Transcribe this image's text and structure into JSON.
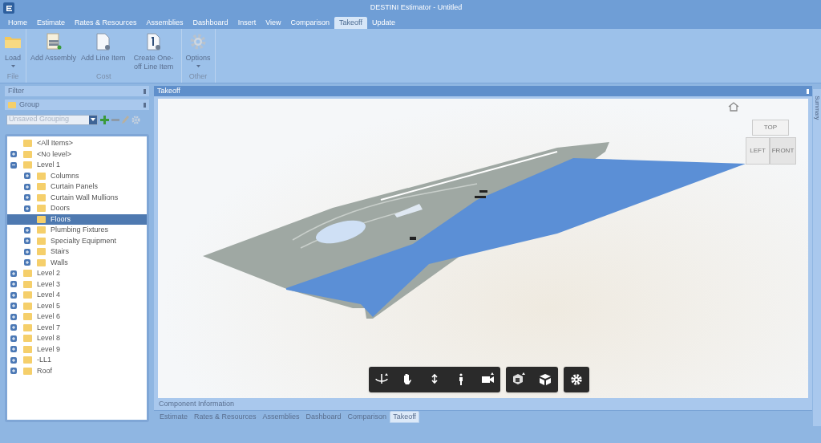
{
  "window": {
    "title": "DESTINI Estimator - Untitled"
  },
  "menu_tabs": [
    {
      "label": "Home",
      "selected": false
    },
    {
      "label": "Estimate",
      "selected": false
    },
    {
      "label": "Rates & Resources",
      "selected": false
    },
    {
      "label": "Assemblies",
      "selected": false
    },
    {
      "label": "Dashboard",
      "selected": false
    },
    {
      "label": "Insert",
      "selected": false
    },
    {
      "label": "View",
      "selected": false
    },
    {
      "label": "Comparison",
      "selected": false
    },
    {
      "label": "Takeoff",
      "selected": true
    },
    {
      "label": "Update",
      "selected": false
    }
  ],
  "ribbon_groups": [
    {
      "label": "File",
      "buttons": [
        {
          "kind": "folder",
          "label": "Load",
          "dropdown": true
        }
      ]
    },
    {
      "label": "Cost",
      "buttons": [
        {
          "kind": "assembly",
          "label": "Add Assembly",
          "dropdown": false
        },
        {
          "kind": "line",
          "label": "Add Line Item",
          "dropdown": false
        },
        {
          "kind": "oneoff",
          "label": "Create One-off Line Item",
          "dropdown": false
        }
      ]
    },
    {
      "label": "Other",
      "buttons": [
        {
          "kind": "gear",
          "label": "Options",
          "dropdown": true
        }
      ]
    }
  ],
  "filter_panel": {
    "title": "Filter",
    "group_title": "Group",
    "grouping_placeholder": "Unsaved Grouping",
    "tree": [
      {
        "label": "<All Items>",
        "selected": false
      },
      {
        "label": "<No level>",
        "expanded": false,
        "selected": false
      },
      {
        "label": "Level 1",
        "expanded": true,
        "selected": false,
        "children": [
          {
            "label": "Columns",
            "expanded": false,
            "selected": false
          },
          {
            "label": "Curtain Panels",
            "expanded": false,
            "selected": false
          },
          {
            "label": "Curtain Wall Mullions",
            "expanded": false,
            "selected": false
          },
          {
            "label": "Doors",
            "expanded": false,
            "selected": false
          },
          {
            "label": "Floors",
            "selected": true
          },
          {
            "label": "Plumbing Fixtures",
            "expanded": false,
            "selected": false
          },
          {
            "label": "Specialty Equipment",
            "expanded": false,
            "selected": false
          },
          {
            "label": "Stairs",
            "expanded": false,
            "selected": false
          },
          {
            "label": "Walls",
            "expanded": false,
            "selected": false
          }
        ]
      },
      {
        "label": "Level 2",
        "expanded": false,
        "selected": false
      },
      {
        "label": "Level 3",
        "expanded": false,
        "selected": false
      },
      {
        "label": "Level 4",
        "expanded": false,
        "selected": false
      },
      {
        "label": "Level 5",
        "expanded": false,
        "selected": false
      },
      {
        "label": "Level 6",
        "expanded": false,
        "selected": false
      },
      {
        "label": "Level 7",
        "expanded": false,
        "selected": false
      },
      {
        "label": "Level 8",
        "expanded": false,
        "selected": false
      },
      {
        "label": "Level 9",
        "expanded": false,
        "selected": false
      },
      {
        "label": "-LL1",
        "expanded": false,
        "selected": false
      },
      {
        "label": "Roof",
        "expanded": false,
        "selected": false
      }
    ]
  },
  "viewer": {
    "title": "Takeoff",
    "view_cube": {
      "top": "TOP",
      "left": "LEFT",
      "front": "FRONT"
    },
    "nav_groups": [
      {
        "tools": [
          {
            "kind": "orbit"
          },
          {
            "kind": "pan"
          },
          {
            "kind": "zoom"
          },
          {
            "kind": "walk"
          },
          {
            "kind": "camera"
          }
        ]
      },
      {
        "tools": [
          {
            "kind": "fit"
          },
          {
            "kind": "cube"
          }
        ]
      },
      {
        "tools": [
          {
            "kind": "settings"
          }
        ]
      }
    ],
    "component_info": "Component Information"
  },
  "document_tabs": [
    {
      "label": "Estimate",
      "selected": false
    },
    {
      "label": "Rates & Resources",
      "selected": false
    },
    {
      "label": "Assemblies",
      "selected": false
    },
    {
      "label": "Dashboard",
      "selected": false
    },
    {
      "label": "Comparison",
      "selected": false
    },
    {
      "label": "Takeoff",
      "selected": true
    }
  ],
  "side_tab": "Summary"
}
